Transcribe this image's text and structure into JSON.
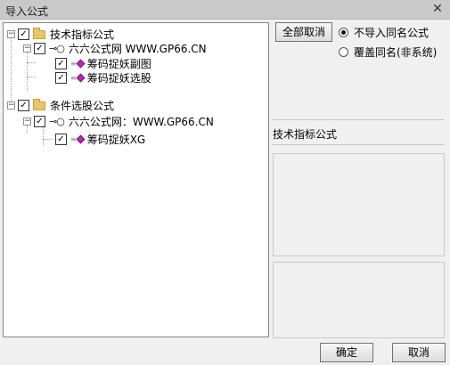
{
  "window": {
    "title": "导入公式",
    "close_glyph": "✕"
  },
  "tree": [
    {
      "label": "技术指标公式",
      "type": "folder",
      "expander": "−",
      "checked": "✓"
    },
    {
      "label": "六六公式网 WWW.GP66.CN",
      "type": "key",
      "expander": "−",
      "checked": "✓"
    },
    {
      "label": "筹码捉妖副图",
      "type": "formula",
      "checked": "✓"
    },
    {
      "label": "筹码捉妖选股",
      "type": "formula",
      "checked": "✓"
    },
    {
      "label": "条件选股公式",
      "type": "folder",
      "expander": "−",
      "checked": "✓"
    },
    {
      "label": "六六公式网：WWW.GP66.CN",
      "type": "key",
      "expander": "−",
      "checked": "✓"
    },
    {
      "label": "筹码捉妖XG",
      "type": "formula",
      "checked": "✓"
    }
  ],
  "buttons": {
    "deselect_all": "全部取消",
    "ok": "确定",
    "cancel": "取消"
  },
  "options": [
    {
      "label": "不导入同名公式",
      "selected": true
    },
    {
      "label": "覆盖同名(非系统)",
      "selected": false
    }
  ],
  "detail": {
    "category_label": "技术指标公式"
  },
  "icons": {
    "key": "⊸○",
    "lines": "≡"
  },
  "colors": {
    "folder": "#e9c46a",
    "formula_gem": "#c51fc5",
    "titlebar": "#c9c9c9"
  }
}
